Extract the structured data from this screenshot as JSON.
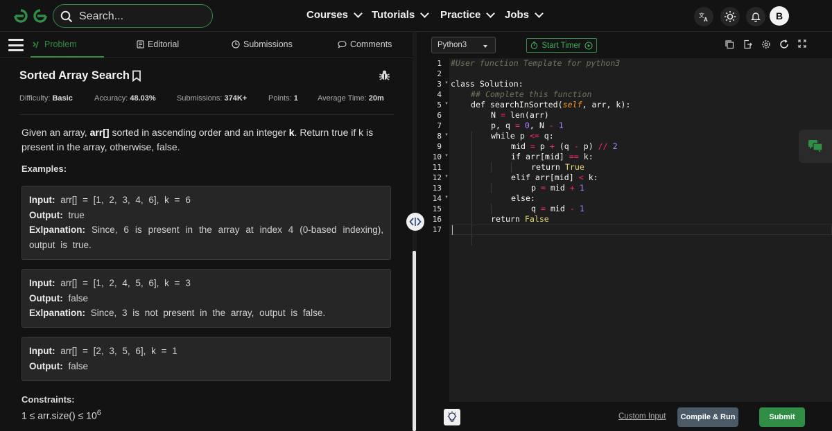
{
  "header": {
    "search_placeholder": "Search...",
    "nav": [
      "Courses",
      "Tutorials",
      "Practice",
      "Jobs"
    ],
    "avatar_letter": "B",
    "brand_color": "#2f8d46"
  },
  "tabs": {
    "problem": "Problem",
    "editorial": "Editorial",
    "submissions": "Submissions",
    "comments": "Comments"
  },
  "problem": {
    "title": "Sorted Array Search",
    "meta": {
      "difficulty_label": "Difficulty:",
      "difficulty": "Basic",
      "accuracy_label": "Accuracy:",
      "accuracy": "48.03%",
      "submissions_label": "Submissions:",
      "submissions": "374K+",
      "points_label": "Points:",
      "points": "1",
      "time_label": "Average Time:",
      "time": "20m"
    },
    "desc_1": "Given an array, ",
    "desc_arr": "arr[]",
    "desc_2": " sorted in ascending order and an integer ",
    "desc_k": "k",
    "desc_3": ". Return true if k is present in the array, otherwise, false.",
    "examples_label": "Examples:",
    "examples": [
      {
        "input_label": "Input:",
        "input": "arr[] = [1, 2, 3, 4, 6], k = 6",
        "output_label": "Output:",
        "output": "true",
        "explanation_label": "Exlpanation:",
        "explanation": "Since, 6 is present in the array at index 4 (0-based indexing), output is true."
      },
      {
        "input_label": "Input:",
        "input": "arr[] = [1, 2, 4, 5, 6], k = 3",
        "output_label": "Output:",
        "output": "false",
        "explanation_label": "Exlpanation:",
        "explanation": "Since, 3 is not present in the array, output is false."
      },
      {
        "input_label": "Input:",
        "input": "arr[] = [2, 3, 5, 6], k = 1",
        "output_label": "Output:",
        "output": "false"
      }
    ],
    "constraints_label": "Constraints:",
    "constraint_base": "1 ≤ arr.size() ≤ 10",
    "constraint_exp": "6"
  },
  "editor": {
    "language": "Python3",
    "timer_label": "Start Timer",
    "line_numbers": [
      "1",
      "2",
      "3",
      "4",
      "5",
      "6",
      "7",
      "8",
      "9",
      "10",
      "11",
      "12",
      "13",
      "14",
      "15",
      "16",
      "17"
    ],
    "lines": {
      "l1": "#User function Template for python3",
      "l3_kw": "class",
      "l3_name": " Solution:",
      "l4": "## Complete this function",
      "l5_a": "def searchInSorted(",
      "l5_self": "self",
      "l5_b": ", arr, k):",
      "l6_a": "N ",
      "l6_op": "=",
      "l6_b": " len(arr)",
      "l7_a": "p, q ",
      "l7_op": "=",
      "l7_n0": "0",
      "l7_b": ", N ",
      "l7_op2": "-",
      "l7_n1": "1",
      "l8_a": "while p ",
      "l8_op": "<=",
      "l8_b": " q:",
      "l9_a": "mid ",
      "l9_op": "=",
      "l9_b": " p ",
      "l9_op2": "+",
      "l9_c": " (q ",
      "l9_op3": "-",
      "l9_d": " p) ",
      "l9_op4": "//",
      "l9_n": "2",
      "l10_a": "if arr[mid] ",
      "l10_op": "==",
      "l10_b": " k:",
      "l11_a": "return ",
      "l11_c": "True",
      "l12_a": "elif arr[mid] ",
      "l12_op": "<",
      "l12_b": " k:",
      "l13_a": "p ",
      "l13_op": "=",
      "l13_b": " mid ",
      "l13_op2": "+",
      "l13_n": "1",
      "l14": "else:",
      "l15_a": "q ",
      "l15_op": "=",
      "l15_b": " mid ",
      "l15_op2": "-",
      "l15_n": "1",
      "l16_a": "return ",
      "l16_c": "False"
    }
  },
  "footer": {
    "custom_input": "Custom Input",
    "compile_run": "Compile & Run",
    "submit": "Submit"
  }
}
